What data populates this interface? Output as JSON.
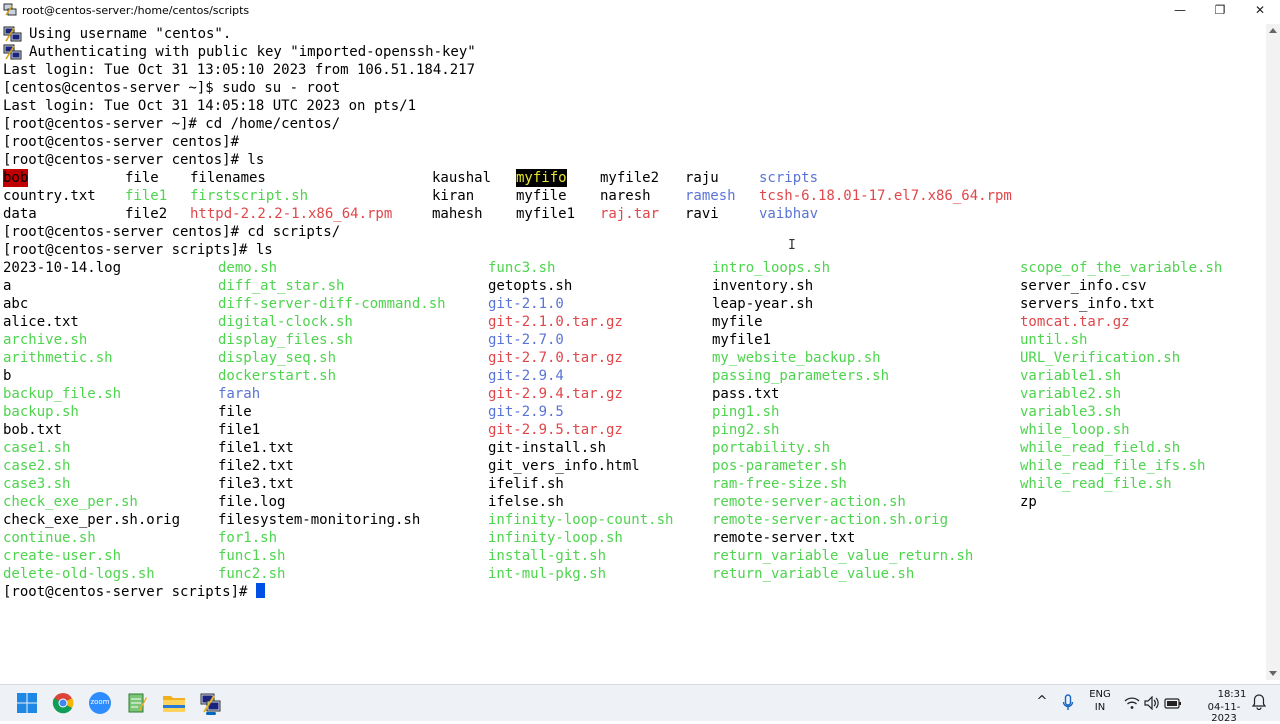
{
  "window": {
    "title": "root@centos-server:/home/centos/scripts",
    "minimize_glyph": "—",
    "maximize_glyph": "❐",
    "close_glyph": "✕"
  },
  "terminal": {
    "lines": [
      {
        "icon": true,
        "text": "Using username \"centos\"."
      },
      {
        "icon": true,
        "text": "Authenticating with public key \"imported-openssh-key\""
      },
      {
        "text": "Last login: Tue Oct 31 13:05:10 2023 from 106.51.184.217"
      },
      {
        "text": "[centos@centos-server ~]$ sudo su - root"
      },
      {
        "text": "Last login: Tue Oct 31 14:05:18 UTC 2023 on pts/1"
      },
      {
        "text": "[root@centos-server ~]# cd /home/centos/"
      },
      {
        "text": "[root@centos-server centos]#"
      },
      {
        "text": "[root@centos-server centos]# ls"
      }
    ],
    "ls_centos": [
      [
        {
          "t": "bob",
          "k": "bob"
        },
        {
          "t": "file",
          "k": "plain"
        },
        {
          "t": "filenames",
          "k": "plain"
        },
        {
          "t": "kaushal",
          "k": "plain"
        },
        {
          "t": "myfifo",
          "k": "fifo"
        },
        {
          "t": "myfile2",
          "k": "plain"
        },
        {
          "t": "raju",
          "k": "plain"
        },
        {
          "t": "scripts",
          "k": "dir"
        }
      ],
      [
        {
          "t": "country.txt",
          "k": "plain"
        },
        {
          "t": "file1",
          "k": "exec"
        },
        {
          "t": "firstscript.sh",
          "k": "exec"
        },
        {
          "t": "kiran",
          "k": "plain"
        },
        {
          "t": "myfile",
          "k": "plain"
        },
        {
          "t": "naresh",
          "k": "plain"
        },
        {
          "t": "ramesh",
          "k": "dir"
        },
        {
          "t": "tcsh-6.18.01-17.el7.x86_64.rpm",
          "k": "archive"
        }
      ],
      [
        {
          "t": "data",
          "k": "plain"
        },
        {
          "t": "file2",
          "k": "plain"
        },
        {
          "t": "httpd-2.2.2-1.x86_64.rpm",
          "k": "archive"
        },
        {
          "t": "mahesh",
          "k": "plain"
        },
        {
          "t": "myfile1",
          "k": "plain"
        },
        {
          "t": "raj.tar",
          "k": "archive"
        },
        {
          "t": "ravi",
          "k": "plain"
        },
        {
          "t": "vaibhav",
          "k": "dir"
        }
      ]
    ],
    "after_centos_ls": [
      "[root@centos-server centos]# cd scripts/",
      "[root@centos-server scripts]# ls"
    ],
    "ls_scripts_columns": [
      [
        {
          "t": "2023-10-14.log",
          "k": "plain"
        },
        {
          "t": "a",
          "k": "plain"
        },
        {
          "t": "abc",
          "k": "plain"
        },
        {
          "t": "alice.txt",
          "k": "plain"
        },
        {
          "t": "archive.sh",
          "k": "exec"
        },
        {
          "t": "arithmetic.sh",
          "k": "exec"
        },
        {
          "t": "b",
          "k": "plain"
        },
        {
          "t": "backup_file.sh",
          "k": "exec"
        },
        {
          "t": "backup.sh",
          "k": "exec"
        },
        {
          "t": "bob.txt",
          "k": "plain"
        },
        {
          "t": "case1.sh",
          "k": "exec"
        },
        {
          "t": "case2.sh",
          "k": "exec"
        },
        {
          "t": "case3.sh",
          "k": "exec"
        },
        {
          "t": "check_exe_per.sh",
          "k": "exec"
        },
        {
          "t": "check_exe_per.sh.orig",
          "k": "plain"
        },
        {
          "t": "continue.sh",
          "k": "exec"
        },
        {
          "t": "create-user.sh",
          "k": "exec"
        },
        {
          "t": "delete-old-logs.sh",
          "k": "exec"
        }
      ],
      [
        {
          "t": "demo.sh",
          "k": "exec"
        },
        {
          "t": "diff_at_star.sh",
          "k": "exec"
        },
        {
          "t": "diff-server-diff-command.sh",
          "k": "exec"
        },
        {
          "t": "digital-clock.sh",
          "k": "exec"
        },
        {
          "t": "display_files.sh",
          "k": "exec"
        },
        {
          "t": "display_seq.sh",
          "k": "exec"
        },
        {
          "t": "dockerstart.sh",
          "k": "exec"
        },
        {
          "t": "farah",
          "k": "dir"
        },
        {
          "t": "file",
          "k": "plain"
        },
        {
          "t": "file1",
          "k": "plain"
        },
        {
          "t": "file1.txt",
          "k": "plain"
        },
        {
          "t": "file2.txt",
          "k": "plain"
        },
        {
          "t": "file3.txt",
          "k": "plain"
        },
        {
          "t": "file.log",
          "k": "plain"
        },
        {
          "t": "filesystem-monitoring.sh",
          "k": "plain"
        },
        {
          "t": "for1.sh",
          "k": "exec"
        },
        {
          "t": "func1.sh",
          "k": "exec"
        },
        {
          "t": "func2.sh",
          "k": "exec"
        }
      ],
      [
        {
          "t": "func3.sh",
          "k": "exec"
        },
        {
          "t": "getopts.sh",
          "k": "plain"
        },
        {
          "t": "git-2.1.0",
          "k": "dir"
        },
        {
          "t": "git-2.1.0.tar.gz",
          "k": "archive"
        },
        {
          "t": "git-2.7.0",
          "k": "dir"
        },
        {
          "t": "git-2.7.0.tar.gz",
          "k": "archive"
        },
        {
          "t": "git-2.9.4",
          "k": "dir"
        },
        {
          "t": "git-2.9.4.tar.gz",
          "k": "archive"
        },
        {
          "t": "git-2.9.5",
          "k": "dir"
        },
        {
          "t": "git-2.9.5.tar.gz",
          "k": "archive"
        },
        {
          "t": "git-install.sh",
          "k": "plain"
        },
        {
          "t": "git_vers_info.html",
          "k": "plain"
        },
        {
          "t": "ifelif.sh",
          "k": "plain"
        },
        {
          "t": "ifelse.sh",
          "k": "plain"
        },
        {
          "t": "infinity-loop-count.sh",
          "k": "exec"
        },
        {
          "t": "infinity-loop.sh",
          "k": "exec"
        },
        {
          "t": "install-git.sh",
          "k": "exec"
        },
        {
          "t": "int-mul-pkg.sh",
          "k": "exec"
        }
      ],
      [
        {
          "t": "intro_loops.sh",
          "k": "exec"
        },
        {
          "t": "inventory.sh",
          "k": "plain"
        },
        {
          "t": "leap-year.sh",
          "k": "plain"
        },
        {
          "t": "myfile",
          "k": "plain"
        },
        {
          "t": "myfile1",
          "k": "plain"
        },
        {
          "t": "my_website_backup.sh",
          "k": "exec"
        },
        {
          "t": "passing_parameters.sh",
          "k": "exec"
        },
        {
          "t": "pass.txt",
          "k": "plain"
        },
        {
          "t": "ping1.sh",
          "k": "exec"
        },
        {
          "t": "ping2.sh",
          "k": "exec"
        },
        {
          "t": "portability.sh",
          "k": "exec"
        },
        {
          "t": "pos-parameter.sh",
          "k": "exec"
        },
        {
          "t": "ram-free-size.sh",
          "k": "exec"
        },
        {
          "t": "remote-server-action.sh",
          "k": "exec"
        },
        {
          "t": "remote-server-action.sh.orig",
          "k": "exec"
        },
        {
          "t": "remote-server.txt",
          "k": "plain"
        },
        {
          "t": "return_variable_value_return.sh",
          "k": "exec"
        },
        {
          "t": "return_variable_value.sh",
          "k": "exec"
        }
      ],
      [
        {
          "t": "scope_of_the_variable.sh",
          "k": "exec"
        },
        {
          "t": "server_info.csv",
          "k": "plain"
        },
        {
          "t": "servers_info.txt",
          "k": "plain"
        },
        {
          "t": "tomcat.tar.gz",
          "k": "archive"
        },
        {
          "t": "until.sh",
          "k": "exec"
        },
        {
          "t": "URL_Verification.sh",
          "k": "exec"
        },
        {
          "t": "variable1.sh",
          "k": "exec"
        },
        {
          "t": "variable2.sh",
          "k": "exec"
        },
        {
          "t": "variable3.sh",
          "k": "exec"
        },
        {
          "t": "while_loop.sh",
          "k": "exec"
        },
        {
          "t": "while_read_field.sh",
          "k": "exec"
        },
        {
          "t": "while_read_file_ifs.sh",
          "k": "exec"
        },
        {
          "t": "while_read_file.sh",
          "k": "exec"
        },
        {
          "t": "zp",
          "k": "plain"
        }
      ]
    ],
    "final_prompt": "[root@centos-server scripts]# "
  },
  "taskbar": {
    "icons": [
      "windows-start-icon",
      "chrome-icon",
      "zoom-icon",
      "notepad-icon",
      "file-explorer-icon",
      "putty-icon"
    ],
    "zoom_label": "zoom",
    "lang_top": "ENG",
    "lang_bottom": "IN",
    "time": "18:31",
    "date": "04-11-2023",
    "tray_up": "^"
  },
  "colors": {
    "exec": "#4ed44e",
    "archive": "#e0464a",
    "dir": "#5a74d6"
  }
}
